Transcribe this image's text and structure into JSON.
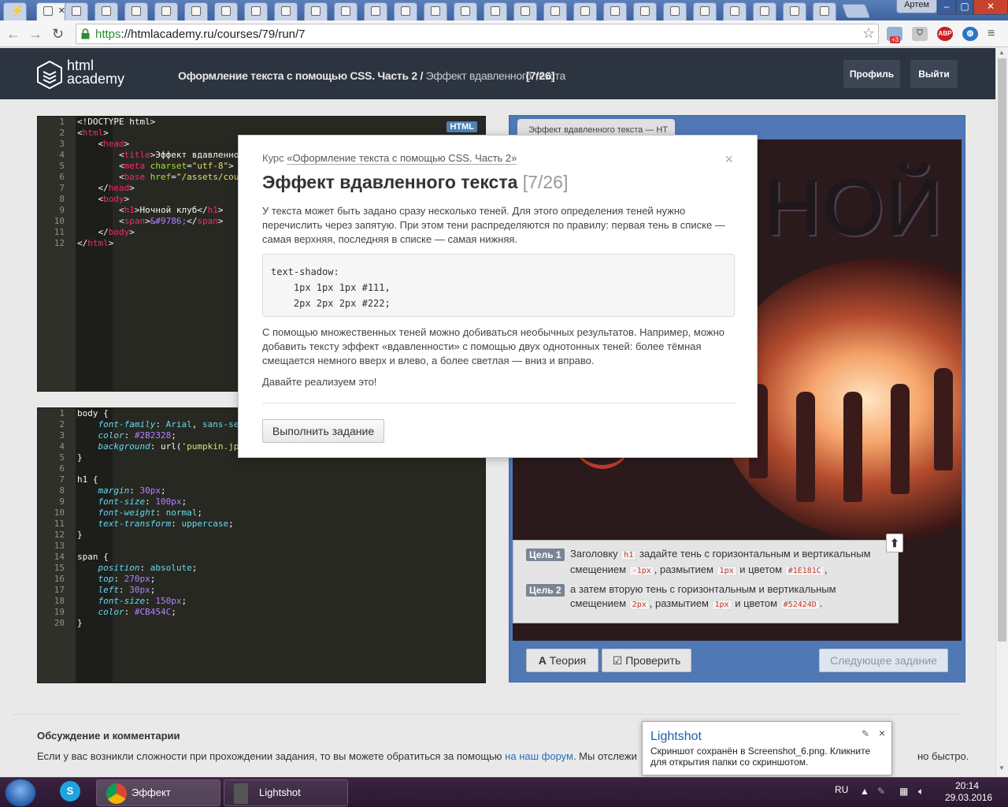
{
  "browser": {
    "url_https": "https",
    "url_rest": "://htmlacademy.ru/courses/79/run/7",
    "user_name": "Артем",
    "ext_badge": "+3",
    "ext_abp": "ABP"
  },
  "header": {
    "logo_line1": "html",
    "logo_line2": "academy",
    "course_title": "Оформление текста с помощью CSS. Часть 2 /",
    "lesson_title": "Эффект вдавленного текста",
    "step": "[7/26]",
    "profile_btn": "Профиль",
    "logout_btn": "Выйти"
  },
  "html_editor": {
    "badge": "HTML",
    "lines": [
      "1",
      "2",
      "3",
      "4",
      "5",
      "6",
      "7",
      "8",
      "9",
      "10",
      "11",
      "12"
    ]
  },
  "css_editor": {
    "lines": [
      "1",
      "2",
      "3",
      "4",
      "5",
      "6",
      "7",
      "8",
      "9",
      "10",
      "11",
      "12",
      "13",
      "14",
      "15",
      "16",
      "17",
      "18",
      "19",
      "20"
    ]
  },
  "preview": {
    "tab_title": "Эффект вдавленного текста — HT",
    "heading_visible": "НОЙ",
    "goals": [
      {
        "label": "Цель 1"
      },
      {
        "label": "Цель 2"
      }
    ],
    "toggle": "⬆",
    "theory_btn": "Теория",
    "check_btn": "Проверить",
    "next_btn": "Следующее задание"
  },
  "modal": {
    "course_prefix": "Курс",
    "course_link": "«Оформление текста с помощью CSS. Часть 2»",
    "close": "×",
    "title": "Эффект вдавленного текста",
    "count": "[7/26]",
    "p1": "У текста может быть задано сразу несколько теней. Для этого определения теней нужно перечислить через запятую. При этом тени распределяются по правилу: первая тень в списке — самая верхняя, последняя в списке — самая нижняя.",
    "code": "text-shadow:\n    1px 1px 1px #111,\n    2px 2px 2px #222;",
    "p2": "С помощью множественных теней можно добиваться необычных результатов. Например, можно добавить тексту эффект «вдавленности» с помощью двух однотонных теней: более тёмная смещается немного вверх и влево, а более светлая — вниз и вправо.",
    "p3": "Давайте реализуем это!",
    "button": "Выполнить задание"
  },
  "discussion": {
    "title": "Обсуждение и комментарии",
    "text_before": "Если у вас возникли сложности при прохождении задания, то вы можете обратиться за помощью",
    "link": "на наш форум",
    "text_after": ". Мы отслежи",
    "text_end": "но быстро."
  },
  "lightshot": {
    "title": "Lightshot",
    "text": "Скриншот сохранён в Screenshot_6.png. Кликните для открытия папки со скриншотом.",
    "close": "×"
  },
  "taskbar": {
    "chrome_label": "Эффект вдавлен...",
    "lightshot_label": "Lightshot",
    "lang": "RU",
    "time": "20:14",
    "date": "29.03.2016"
  }
}
